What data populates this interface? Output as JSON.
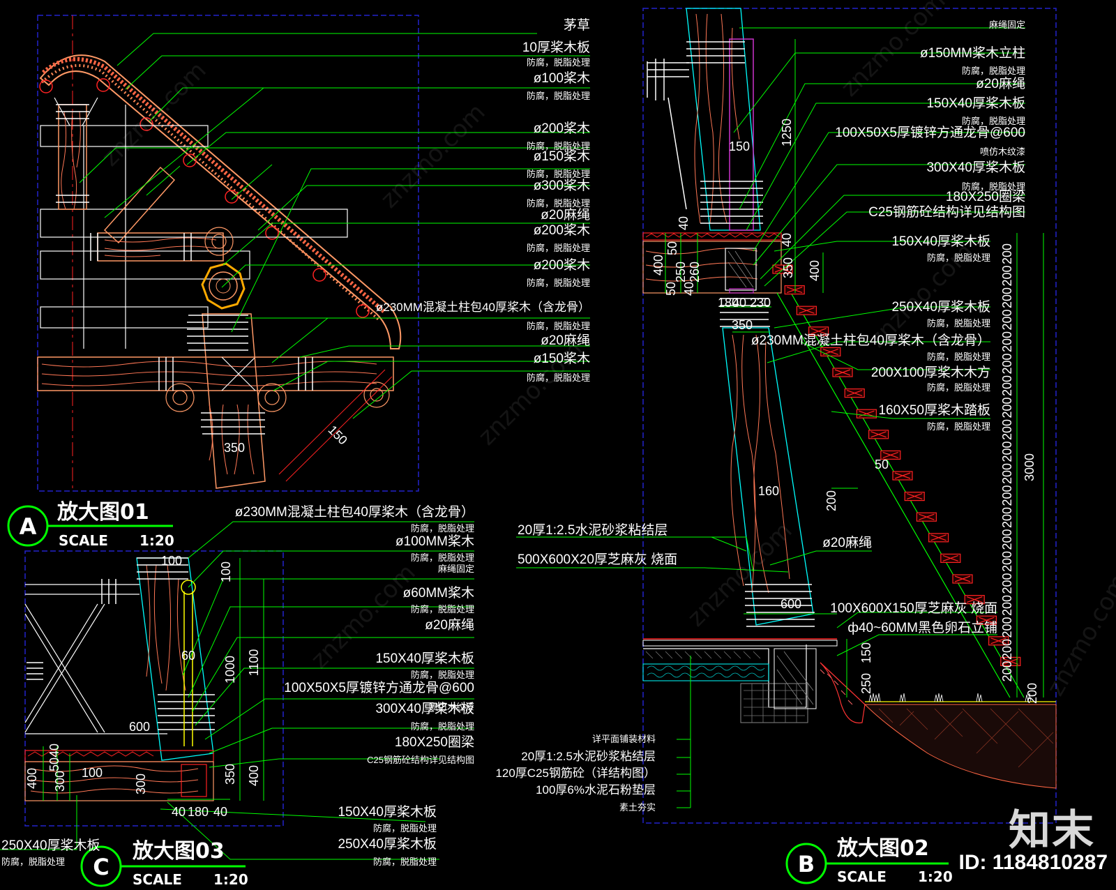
{
  "detail_a": {
    "title": "放大图01",
    "letter": "A",
    "scale_label": "SCALE",
    "scale_value": "1:20",
    "labels": [
      "茅草",
      "10厚桨木板",
      "防腐，脱脂处理",
      "ø100桨木",
      "防腐，脱脂处理",
      "ø200桨木",
      "防腐，脱脂处理",
      "ø150桨木",
      "防腐，脱脂处理",
      "ø300桨木",
      "防腐，脱脂处理",
      "ø20麻绳",
      "ø200桨木",
      "防腐，脱脂处理",
      "ø200桨木",
      "防腐，脱脂处理",
      "ø230MM混凝土柱包40厚桨木（含龙骨）",
      "防腐，脱脂处理",
      "ø20麻绳",
      "ø150桨木",
      "防腐，脱脂处理"
    ],
    "dims": [
      "350",
      "150"
    ]
  },
  "detail_b": {
    "title": "放大图02",
    "letter": "B",
    "scale_label": "SCALE",
    "scale_value": "1:20",
    "labels": [
      "麻绳固定",
      "ø150MM桨木立柱",
      "防腐，脱脂处理",
      "ø20麻绳",
      "150X40厚桨木板",
      "防腐，脱脂处理",
      "100X50X5厚镀锌方通龙骨@600",
      "喷仿木纹漆",
      "300X40厚桨木板",
      "防腐，脱脂处理",
      "180X250圈梁",
      "C25钢筋砼结构详见结构图",
      "150X40厚桨木板",
      "防腐，脱脂处理",
      "250X40厚桨木板",
      "防腐，脱脂处理",
      "ø230MM混凝土柱包40厚桨木（含龙骨）",
      "防腐，脱脂处理",
      "200X100厚桨木木方",
      "防腐，脱脂处理",
      "160X50厚桨木踏板",
      "防腐，脱脂处理",
      "ø20麻绳",
      "100X600X150厚芝麻灰 烧面",
      "ф40~60MM黑色卵石立铺"
    ],
    "left_labels": [
      "20厚1:2.5水泥砂浆粘结层",
      "500X600X20厚芝麻灰 烧面"
    ],
    "bottom_labels": [
      "详平面铺装材料",
      "20厚1:2.5水泥砂浆粘结层",
      "120厚C25钢筋砼（详结构图）",
      "100厚6%水泥石粉垫层",
      "素土夯实"
    ],
    "dims": [
      "150",
      "1250",
      "40",
      "50",
      "400",
      "250",
      "50",
      "40",
      "260",
      "350",
      "400",
      "40",
      "180",
      "40",
      "230",
      "350",
      "160",
      "50",
      "200",
      "600",
      "150",
      "250",
      "3000",
      "200"
    ],
    "stair_dims": [
      "200",
      "200",
      "200",
      "200",
      "200",
      "200",
      "200",
      "200",
      "200",
      "200",
      "200",
      "200",
      "200",
      "200",
      "200",
      "200",
      "200",
      "200",
      "200",
      "200"
    ]
  },
  "detail_c": {
    "title": "放大图03",
    "letter": "C",
    "scale_label": "SCALE",
    "scale_value": "1:20",
    "labels": [
      "ø230MM混凝土柱包40厚桨木（含龙骨）",
      "防腐，脱脂处理",
      "ø100MM桨木",
      "防腐，脱脂处理",
      "麻绳固定",
      "ø60MM桨木",
      "防腐，脱脂处理",
      "ø20麻绳",
      "150X40厚桨木板",
      "防腐，脱脂处理",
      "100X50X5厚镀锌方通龙骨@600",
      "喷仿木纹漆",
      "300X40厚桨木板",
      "防腐，脱脂处理",
      "180X250圈梁",
      "C25钢筋砼结构详见结构图",
      "150X40厚桨木板",
      "防腐，脱脂处理",
      "250X40厚桨木板",
      "防腐，脱脂处理"
    ],
    "left_label": "250X40厚桨木板",
    "left_label2": "防腐，脱脂处理",
    "dims": [
      "100",
      "100",
      "60",
      "1000",
      "1100",
      "600",
      "40",
      "50",
      "300",
      "400",
      "100",
      "300",
      "350",
      "400",
      "40",
      "180",
      "40"
    ]
  },
  "watermark": "znzmo.com",
  "watermark_cn": "知末网",
  "brand": "知末",
  "id_text": "ID: 1184810287",
  "colors": {
    "leader": "#00ff00",
    "frame": "#2222cc",
    "wood": "#ff9966",
    "rope": "#ffffff",
    "red": "#ff2222",
    "cyan": "#00ffff",
    "yellow": "#ffff00"
  }
}
